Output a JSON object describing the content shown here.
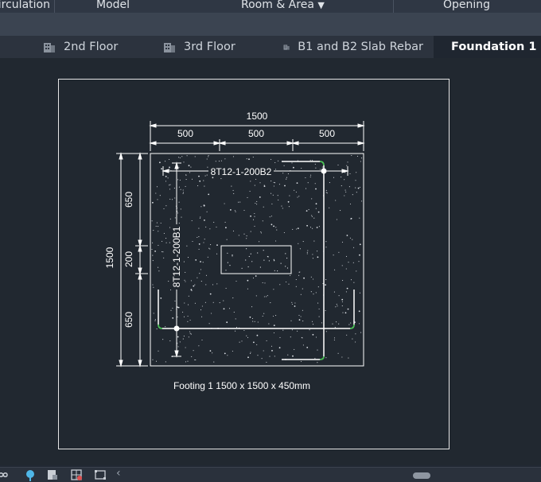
{
  "ribbon": {
    "items": [
      "Circulation",
      "Model",
      "Room & Area",
      "Opening"
    ]
  },
  "tabs": [
    {
      "label": "2nd Floor",
      "active": false
    },
    {
      "label": "3rd Floor",
      "active": false
    },
    {
      "label": "B1 and B2 Slab Rebar",
      "active": false
    },
    {
      "label": "Foundation 1",
      "active": true
    }
  ],
  "drawing": {
    "dims_top": {
      "overall": "1500",
      "left": "500",
      "middle": "500",
      "right": "500"
    },
    "dims_left": {
      "overall": "1500",
      "top": "650",
      "middle": "200",
      "bottom": "650"
    },
    "rebar_b2": "8T12-1-200B2",
    "rebar_b1": "8T12-1-200B1",
    "caption": "Footing 1 1500 x 1500 x 450mm"
  },
  "colors": {
    "background": "#212830",
    "lines": "#ffffff",
    "accent_green": "#3fc14a",
    "status_accent": "#4fb7e8"
  }
}
